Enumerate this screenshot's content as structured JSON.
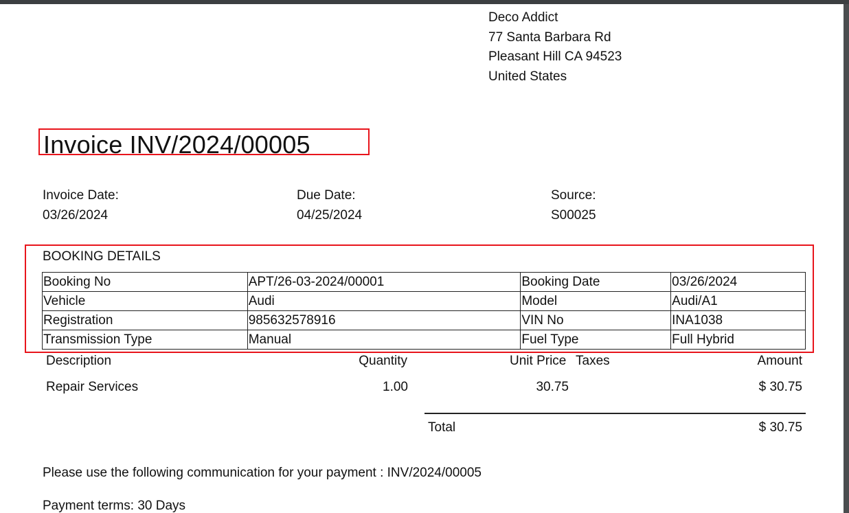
{
  "customer_address": {
    "name": "Deco Addict",
    "street": "77 Santa Barbara Rd",
    "city_line": "Pleasant Hill CA 94523",
    "country": "United States"
  },
  "invoice": {
    "title": "Invoice INV/2024/00005",
    "invoice_date_label": "Invoice Date:",
    "invoice_date": "03/26/2024",
    "due_date_label": "Due Date:",
    "due_date": "04/25/2024",
    "source_label": "Source:",
    "source": "S00025"
  },
  "booking": {
    "title": "BOOKING DETAILS",
    "rows": [
      [
        "Booking No",
        "APT/26-03-2024/00001",
        "Booking Date",
        "03/26/2024"
      ],
      [
        "Vehicle",
        "Audi",
        "Model",
        "Audi/A1"
      ],
      [
        "Registration",
        "985632578916",
        "VIN No",
        "INA1038"
      ],
      [
        "Transmission Type",
        "Manual",
        "Fuel Type",
        "Full Hybrid"
      ]
    ]
  },
  "lines": {
    "headers": {
      "description": "Description",
      "quantity": "Quantity",
      "unit_price": "Unit Price",
      "taxes": "Taxes",
      "amount": "Amount"
    },
    "items": [
      {
        "description": "Repair Services",
        "quantity": "1.00",
        "unit_price": "30.75",
        "taxes": "",
        "amount": "$ 30.75"
      }
    ]
  },
  "totals": {
    "total_label": "Total",
    "total_value": "$ 30.75"
  },
  "footer": {
    "communication": "Please use the following communication for your payment : INV/2024/00005",
    "payment_terms": "Payment terms: 30 Days"
  },
  "colors": {
    "highlight": "#e8141b"
  }
}
